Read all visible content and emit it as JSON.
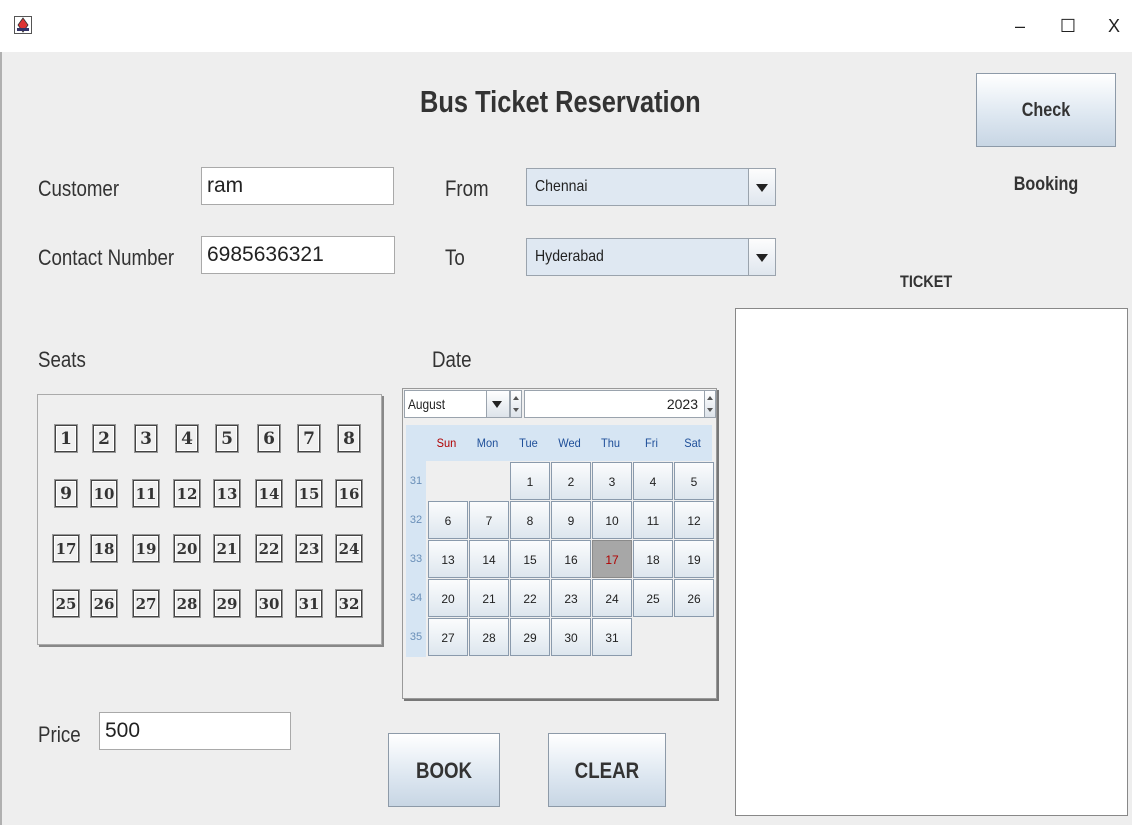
{
  "window": {
    "title": "",
    "minimize_label": "–",
    "maximize_label": "☐",
    "close_label": "X"
  },
  "header": {
    "title": "Bus Ticket Reservation",
    "check_booking_label": "Check Booking"
  },
  "form": {
    "customer_label": "Customer",
    "customer_value": "ram",
    "contact_label": "Contact Number",
    "contact_value": "6985636321",
    "from_label": "From",
    "from_value": "Chennai",
    "to_label": "To",
    "to_value": "Hyderabad",
    "seats_label": "Seats",
    "date_label": "Date",
    "price_label": "Price",
    "price_value": "500"
  },
  "seats": [
    "1",
    "2",
    "3",
    "4",
    "5",
    "6",
    "7",
    "8",
    "9",
    "10",
    "11",
    "12",
    "13",
    "14",
    "15",
    "16",
    "17",
    "18",
    "19",
    "20",
    "21",
    "22",
    "23",
    "24",
    "25",
    "26",
    "27",
    "28",
    "29",
    "30",
    "31",
    "32"
  ],
  "calendar": {
    "month": "August",
    "year": "2023",
    "weekdays": [
      "Sun",
      "Mon",
      "Tue",
      "Wed",
      "Thu",
      "Fri",
      "Sat"
    ],
    "week_numbers": [
      "31",
      "32",
      "33",
      "34",
      "35"
    ],
    "weeks": [
      [
        "",
        "",
        "1",
        "2",
        "3",
        "4",
        "5"
      ],
      [
        "6",
        "7",
        "8",
        "9",
        "10",
        "11",
        "12"
      ],
      [
        "13",
        "14",
        "15",
        "16",
        "17",
        "18",
        "19"
      ],
      [
        "20",
        "21",
        "22",
        "23",
        "24",
        "25",
        "26"
      ],
      [
        "27",
        "28",
        "29",
        "30",
        "31",
        "",
        ""
      ]
    ],
    "selected_day": "17"
  },
  "actions": {
    "book_label": "BOOK",
    "clear_label": "CLEAR"
  },
  "ticket": {
    "label": "TICKET",
    "content": ""
  }
}
